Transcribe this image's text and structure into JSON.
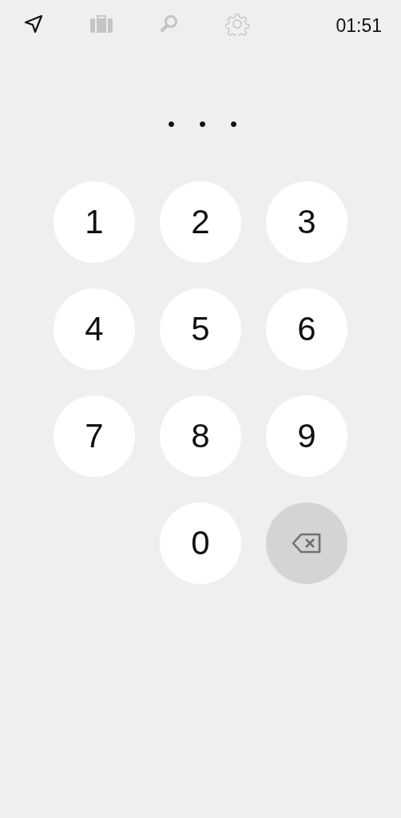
{
  "tabs": [
    {
      "kind": "navigation",
      "selected": true
    },
    {
      "kind": "briefcase",
      "selected": false
    },
    {
      "kind": "search",
      "selected": false
    },
    {
      "kind": "settings",
      "selected": false
    }
  ],
  "clock": "01:51",
  "pin_dots": [
    {
      "filled": true
    },
    {
      "filled": true
    },
    {
      "filled": true
    }
  ],
  "keys": [
    {
      "kind": "digit",
      "label": "1"
    },
    {
      "kind": "digit",
      "label": "2"
    },
    {
      "kind": "digit",
      "label": "3"
    },
    {
      "kind": "digit",
      "label": "4"
    },
    {
      "kind": "digit",
      "label": "5"
    },
    {
      "kind": "digit",
      "label": "6"
    },
    {
      "kind": "digit",
      "label": "7"
    },
    {
      "kind": "digit",
      "label": "8"
    },
    {
      "kind": "digit",
      "label": "9"
    },
    {
      "kind": "blank"
    },
    {
      "kind": "digit",
      "label": "0"
    },
    {
      "kind": "backspace"
    }
  ]
}
